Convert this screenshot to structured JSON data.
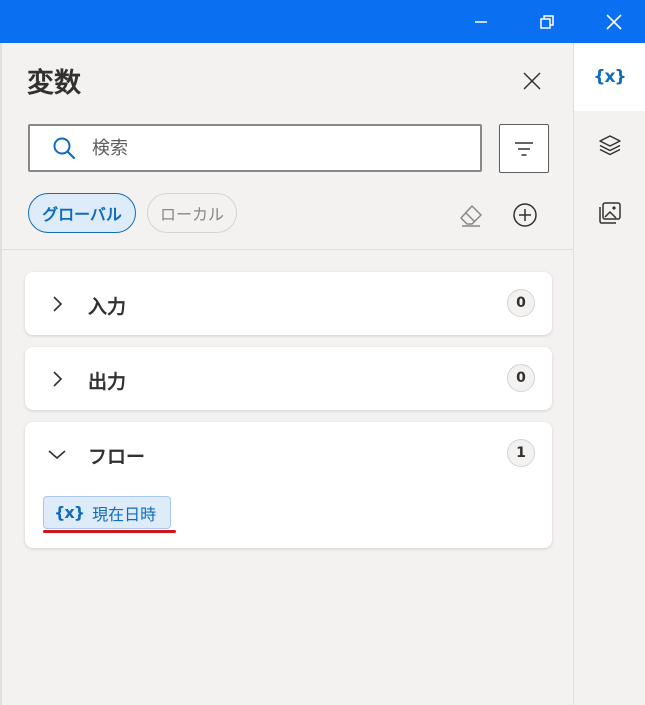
{
  "window": {
    "controls": [
      "minimize",
      "restore",
      "close"
    ],
    "accent_color": "#0a6ff0"
  },
  "panel": {
    "title": "変数",
    "search": {
      "value": "",
      "placeholder": "検索"
    },
    "scope_tabs": [
      {
        "label": "グローバル",
        "selected": true
      },
      {
        "label": "ローカル",
        "selected": false
      }
    ],
    "sections": [
      {
        "label": "入力",
        "count": "0",
        "expanded": false
      },
      {
        "label": "出力",
        "count": "0",
        "expanded": false
      },
      {
        "label": "フロー",
        "count": "1",
        "expanded": true,
        "items": [
          {
            "icon": "{x}",
            "label": "現在日時"
          }
        ]
      }
    ]
  },
  "side_tabs": [
    {
      "icon": "variables-icon",
      "glyph": "{x}",
      "active": true
    },
    {
      "icon": "layers-icon",
      "active": false
    },
    {
      "icon": "images-icon",
      "active": false
    }
  ],
  "colors": {
    "link_blue": "#0f6cbd",
    "highlight_red": "#d1141a"
  }
}
